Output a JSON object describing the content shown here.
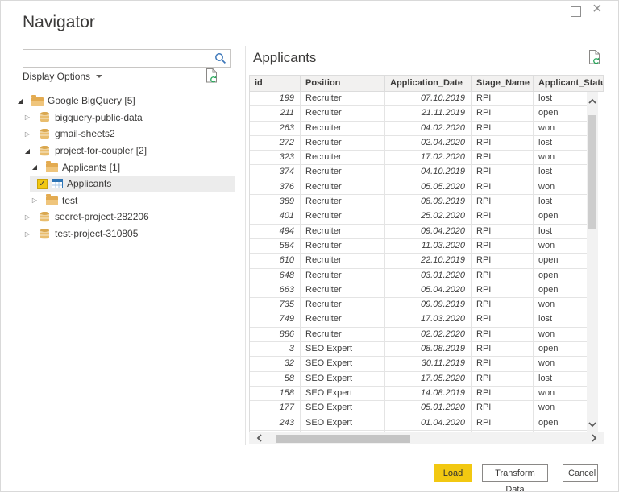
{
  "window": {
    "title": "Navigator"
  },
  "left_panel": {
    "search": {
      "value": "",
      "placeholder": ""
    },
    "display_options_label": "Display Options",
    "tree": [
      {
        "label": "Google BigQuery [5]",
        "level": 0,
        "expander": "expanded",
        "icon": "folder",
        "checked": false,
        "selected": false
      },
      {
        "label": "bigquery-public-data",
        "level": 1,
        "expander": "collapsed",
        "icon": "database",
        "checked": false,
        "selected": false
      },
      {
        "label": "gmail-sheets2",
        "level": 1,
        "expander": "collapsed",
        "icon": "database",
        "checked": false,
        "selected": false
      },
      {
        "label": "project-for-coupler [2]",
        "level": 1,
        "expander": "expanded",
        "icon": "database",
        "checked": false,
        "selected": false
      },
      {
        "label": "Applicants [1]",
        "level": 2,
        "expander": "expanded",
        "icon": "folder",
        "checked": false,
        "selected": false
      },
      {
        "label": "Applicants",
        "level": 3,
        "expander": "none",
        "icon": "table",
        "checked": true,
        "selected": true
      },
      {
        "label": "test",
        "level": 2,
        "expander": "collapsed",
        "icon": "folder",
        "checked": false,
        "selected": false
      },
      {
        "label": "secret-project-282206",
        "level": 1,
        "expander": "collapsed",
        "icon": "database",
        "checked": false,
        "selected": false
      },
      {
        "label": "test-project-310805",
        "level": 1,
        "expander": "collapsed",
        "icon": "database",
        "checked": false,
        "selected": false
      }
    ]
  },
  "preview": {
    "title": "Applicants",
    "columns": [
      "id",
      "Position",
      "Application_Date",
      "Stage_Name",
      "Applicant_Status"
    ],
    "rows": [
      [
        "199",
        "Recruiter",
        "07.10.2019",
        "RPI",
        "lost"
      ],
      [
        "211",
        "Recruiter",
        "21.11.2019",
        "RPI",
        "open"
      ],
      [
        "263",
        "Recruiter",
        "04.02.2020",
        "RPI",
        "won"
      ],
      [
        "272",
        "Recruiter",
        "02.04.2020",
        "RPI",
        "lost"
      ],
      [
        "323",
        "Recruiter",
        "17.02.2020",
        "RPI",
        "won"
      ],
      [
        "374",
        "Recruiter",
        "04.10.2019",
        "RPI",
        "lost"
      ],
      [
        "376",
        "Recruiter",
        "05.05.2020",
        "RPI",
        "won"
      ],
      [
        "389",
        "Recruiter",
        "08.09.2019",
        "RPI",
        "lost"
      ],
      [
        "401",
        "Recruiter",
        "25.02.2020",
        "RPI",
        "open"
      ],
      [
        "494",
        "Recruiter",
        "09.04.2020",
        "RPI",
        "lost"
      ],
      [
        "584",
        "Recruiter",
        "11.03.2020",
        "RPI",
        "won"
      ],
      [
        "610",
        "Recruiter",
        "22.10.2019",
        "RPI",
        "open"
      ],
      [
        "648",
        "Recruiter",
        "03.01.2020",
        "RPI",
        "open"
      ],
      [
        "663",
        "Recruiter",
        "05.04.2020",
        "RPI",
        "open"
      ],
      [
        "735",
        "Recruiter",
        "09.09.2019",
        "RPI",
        "won"
      ],
      [
        "749",
        "Recruiter",
        "17.03.2020",
        "RPI",
        "lost"
      ],
      [
        "886",
        "Recruiter",
        "02.02.2020",
        "RPI",
        "won"
      ],
      [
        "3",
        "SEO Expert",
        "08.08.2019",
        "RPI",
        "open"
      ],
      [
        "32",
        "SEO Expert",
        "30.11.2019",
        "RPI",
        "won"
      ],
      [
        "58",
        "SEO Expert",
        "17.05.2020",
        "RPI",
        "lost"
      ],
      [
        "158",
        "SEO Expert",
        "14.08.2019",
        "RPI",
        "won"
      ],
      [
        "177",
        "SEO Expert",
        "05.01.2020",
        "RPI",
        "won"
      ],
      [
        "243",
        "SEO Expert",
        "01.04.2020",
        "RPI",
        "open"
      ]
    ]
  },
  "footer": {
    "load_label": "Load",
    "transform_label": "Transform Data",
    "cancel_label": "Cancel"
  },
  "colors": {
    "accent": "#f2c811",
    "selected_row": "#ececec",
    "header_bg": "#f2f1f0",
    "grid_line": "#e4e4e4",
    "table_icon_blue": "#2e75b6",
    "folder_gold": "#e3ab51",
    "refresh_green": "#27a65a",
    "search_blue": "#3b76b9"
  }
}
